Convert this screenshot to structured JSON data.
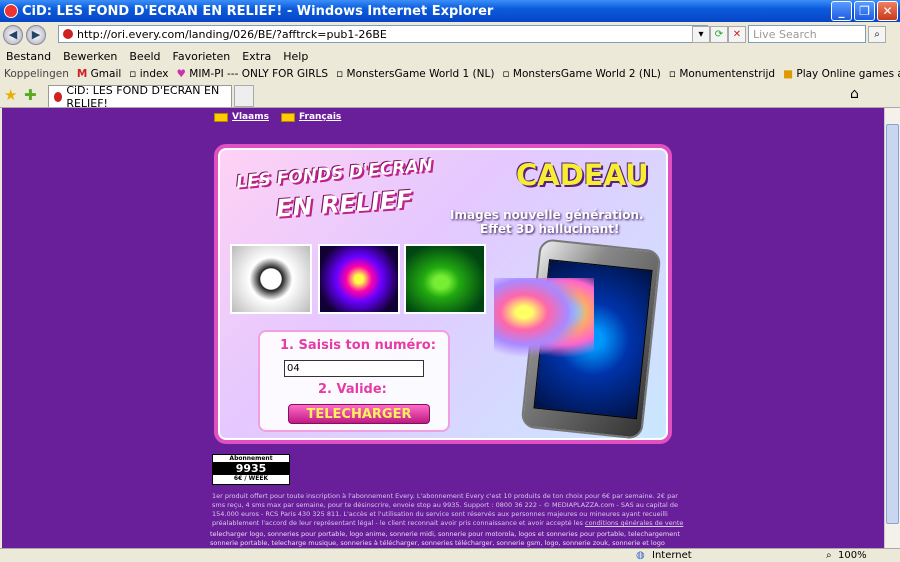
{
  "window": {
    "title": "CiD: LES FOND D'ECRAN EN RELIEF! - Windows Internet Explorer"
  },
  "address": {
    "url": "http://ori.every.com/landing/026/BE/?afftrck=pub1-26BE",
    "search_placeholder": "Live Search"
  },
  "menu": [
    "Bestand",
    "Bewerken",
    "Beeld",
    "Favorieten",
    "Extra",
    "Help"
  ],
  "links": {
    "label": "Koppelingen",
    "items": [
      "Gmail",
      "index",
      "MIM-PI --- ONLY FOR GIRLS",
      "MonstersGame World 1 (NL)",
      "MonstersGame World 2 (NL)",
      "Monumentenstrijd",
      "Play Online games at King.com"
    ]
  },
  "tab": {
    "title": "CiD: LES FOND D'ECRAN EN RELIEF!"
  },
  "page": {
    "languages": [
      "Vlaams",
      "Français"
    ],
    "headline_line1": "LES FONDS D'ECRAN",
    "headline_line2": "EN RELIEF",
    "cadeau": "CADEAU",
    "tagline1": "Images nouvelle génération.",
    "tagline2": "Effet 3D hallucinant!",
    "step1": "1. Saisis ton numéro:",
    "phone_value": "04",
    "step2": "2. Valide:",
    "download": "TELECHARGER",
    "abo_label": "Abonnement",
    "abo_number": "9935",
    "abo_price": "6€ / WEEK",
    "legal_text": "1er produit offert pour toute inscription à l'abonnement Every. L'abonnement Every c'est 10 produits de ton choix pour 6€ par semaine. 2€ par sms reçu, 4 sms max par semaine, pour te désinscrire, envoie stop au 9935. Support : 0800 36 222 - © MEDIAPLAZZA.com - SAS au capital de 154.000 euros - RCS Paris 430 325 811. L'accès et l'utilisation du service sont réservés aux personnes majeures ou mineures ayant recueilli préalablement l'accord de leur représentant légal - le client reconnait avoir pris connaissance et avoir accepté les",
    "legal_link": "conditions générales de vente",
    "footer_text": "telecharger logo, sonneries pour portable, logo anime, sonnerie midi, sonnerie pour motorola, logos et sonneries pour portable, telechargement sonnerie portable, telecharge musique, sonneries à télécharger, sonneries télécharger, sonnerie gsm, logo, sonnerie zouk, sonnerie et logo nokia, sonnerie logo,"
  },
  "status": {
    "zone": "Internet",
    "zoom": "100%"
  }
}
